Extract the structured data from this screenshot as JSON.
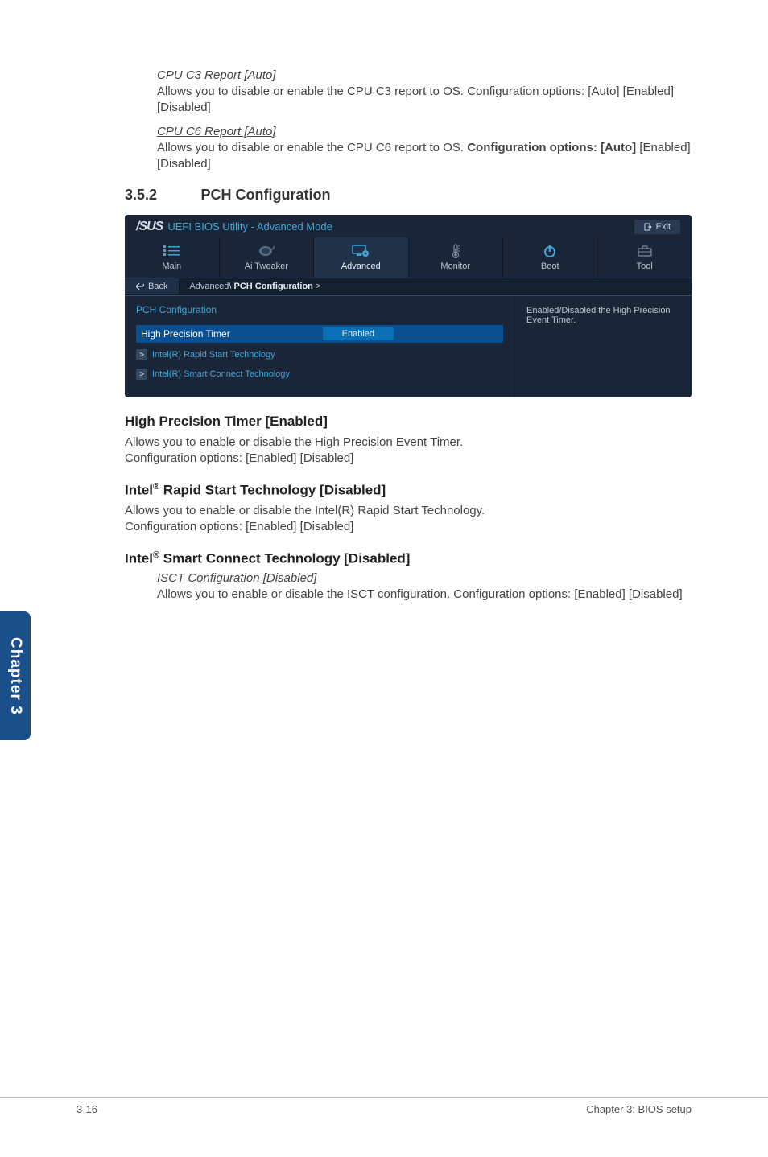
{
  "cpu_c3": {
    "title": "CPU C3 Report [Auto]",
    "desc": "Allows you to disable or enable the CPU C3 report to OS. Configuration options: [Auto] [Enabled] [Disabled]"
  },
  "cpu_c6": {
    "title": "CPU C6 Report [Auto]",
    "desc_pre": "Allows you to disable or enable the CPU C6 report to OS. ",
    "desc_bold": "Configuration options: [Auto]",
    "desc_post": " [Enabled] [Disabled]"
  },
  "section": {
    "num": "3.5.2",
    "title": "PCH Configuration"
  },
  "bios": {
    "logo": "/SUS",
    "uefi": "UEFI BIOS Utility - Advanced Mode",
    "exit": "Exit",
    "tabs": {
      "main": "Main",
      "ai": "Ai Tweaker",
      "advanced": "Advanced",
      "monitor": "Monitor",
      "boot": "Boot",
      "tool": "Tool"
    },
    "back": "Back",
    "breadcrumb_pre": "Advanced\\ ",
    "breadcrumb_strong": "PCH Configuration",
    "breadcrumb_post": " >",
    "pch_title": "PCH Configuration",
    "hpt": "High Precision Timer",
    "enabled": "Enabled",
    "rapid": "Intel(R) Rapid Start Technology",
    "smart": "Intel(R) Smart Connect Technology",
    "help": "Enabled/Disabled the High Precision Event Timer."
  },
  "hpt_setting": {
    "title": "High Precision Timer [Enabled]",
    "desc": "Allows you to enable or disable the High Precision Event Timer.\nConfiguration options: [Enabled] [Disabled]"
  },
  "rapid_setting": {
    "title_pre": "Intel",
    "title_sup": "®",
    "title_post": " Rapid Start Technology [Disabled]",
    "desc": "Allows you to enable or disable the Intel(R) Rapid Start Technology.\nConfiguration options: [Enabled] [Disabled]"
  },
  "smart_setting": {
    "title_pre": "Intel",
    "title_sup": "®",
    "title_post": " Smart Connect Technology [Disabled]",
    "isct_title": "ISCT Configuration [Disabled]",
    "isct_desc": "Allows you to enable or disable the ISCT configuration. Configuration options: [Enabled] [Disabled]"
  },
  "chapter_tab": "Chapter 3",
  "footer": {
    "left": "3-16",
    "right": "Chapter 3: BIOS setup"
  }
}
